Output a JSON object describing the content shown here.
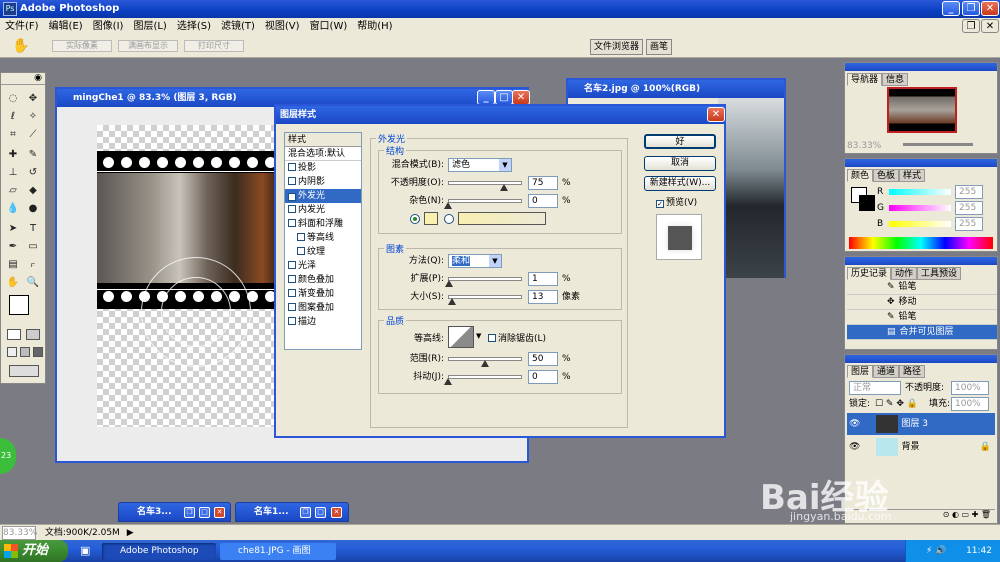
{
  "app": {
    "title": "Adobe Photoshop"
  },
  "menu": [
    "文件(F)",
    "编辑(E)",
    "图像(I)",
    "图层(L)",
    "选择(S)",
    "滤镜(T)",
    "视图(V)",
    "窗口(W)",
    "帮助(H)"
  ],
  "options_bar": {
    "buttons": [
      "实际像素",
      "满画布显示",
      "打印尺寸"
    ],
    "palette_well": [
      "文件浏览器",
      "画笔"
    ]
  },
  "doc_main": {
    "title": "mingChe1 @ 83.3% (图层 3, RGB)"
  },
  "doc_second": {
    "title": "名车2.jpg @ 100%(RGB)"
  },
  "minimized": [
    {
      "title": "名车3..."
    },
    {
      "title": "名车1..."
    }
  ],
  "dialog": {
    "title": "图层样式",
    "list_header": "样式",
    "list_default": "混合选项:默认",
    "styles": [
      {
        "label": "投影",
        "checked": false,
        "indent": false
      },
      {
        "label": "内阴影",
        "checked": false,
        "indent": false
      },
      {
        "label": "外发光",
        "checked": true,
        "indent": false,
        "selected": true
      },
      {
        "label": "内发光",
        "checked": false,
        "indent": false
      },
      {
        "label": "斜面和浮雕",
        "checked": false,
        "indent": false
      },
      {
        "label": "等高线",
        "checked": false,
        "indent": true
      },
      {
        "label": "纹理",
        "checked": false,
        "indent": true
      },
      {
        "label": "光泽",
        "checked": false,
        "indent": false
      },
      {
        "label": "颜色叠加",
        "checked": false,
        "indent": false
      },
      {
        "label": "渐变叠加",
        "checked": false,
        "indent": false
      },
      {
        "label": "图案叠加",
        "checked": false,
        "indent": false
      },
      {
        "label": "描边",
        "checked": false,
        "indent": false
      }
    ],
    "section_title": "外发光",
    "structure": {
      "label": "结构",
      "blend_mode_label": "混合模式(B):",
      "blend_mode": "滤色",
      "opacity_label": "不透明度(O):",
      "opacity": "75",
      "opacity_fraction": 0.75,
      "noise_label": "杂色(N):",
      "noise": "0",
      "noise_fraction": 0.0,
      "percent": "%"
    },
    "elements": {
      "label": "图素",
      "method_label": "方法(Q):",
      "method": "柔和",
      "spread_label": "扩展(P):",
      "spread": "1",
      "spread_fraction": 0.01,
      "size_label": "大小(S):",
      "size": "13",
      "size_fraction": 0.05,
      "size_unit": "像素",
      "percent": "%"
    },
    "quality": {
      "label": "品质",
      "contour_label": "等高线:",
      "antialias_label": "消除锯齿(L)",
      "range_label": "范围(R):",
      "range": "50",
      "range_fraction": 0.5,
      "jitter_label": "抖动(J):",
      "jitter": "0",
      "jitter_fraction": 0.0,
      "percent": "%"
    },
    "buttons": {
      "ok": "好",
      "cancel": "取消",
      "new_style": "新建样式(W)...",
      "preview": "预览(V)"
    },
    "glow_color": "#f8efb0"
  },
  "navigator": {
    "tabs": [
      "导航器",
      "信息"
    ],
    "zoom": "83.33%"
  },
  "color_panel": {
    "tabs": [
      "颜色",
      "色板",
      "样式"
    ],
    "channels": [
      {
        "label": "R",
        "value": "255"
      },
      {
        "label": "G",
        "value": "255"
      },
      {
        "label": "B",
        "value": "255"
      }
    ]
  },
  "history_panel": {
    "tabs": [
      "历史记录",
      "动作",
      "工具预设"
    ],
    "items": [
      "铅笔",
      "移动",
      "铅笔",
      "合并可见图层"
    ]
  },
  "layers_panel": {
    "tabs": [
      "图层",
      "通道",
      "路径"
    ],
    "blend": "正常",
    "opacity_label": "不透明度:",
    "opacity": "100%",
    "lock_label": "锁定:",
    "fill_label": "填充:",
    "fill": "100%",
    "layers": [
      {
        "name": "图层 3",
        "selected": true
      },
      {
        "name": "背景",
        "selected": false
      }
    ]
  },
  "status": {
    "zoom": "83.33%",
    "doc": "文档:900K/2.05M"
  },
  "taskbar": {
    "start": "开始",
    "tasks": [
      "Adobe Photoshop",
      "che81.JPG - 画图"
    ],
    "clock": "11:42"
  },
  "badge": "23",
  "watermark": {
    "brand": "Bai经验",
    "url": "jingyan.baidu.com"
  }
}
